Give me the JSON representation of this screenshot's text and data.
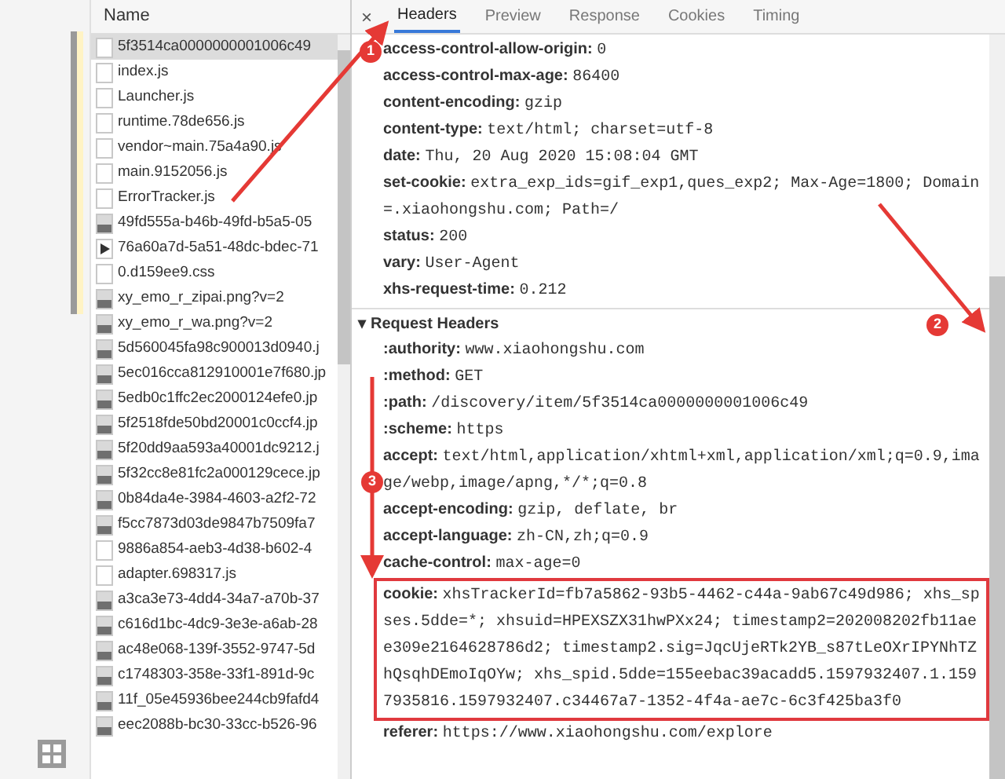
{
  "files": {
    "column": "Name",
    "items": [
      {
        "name": "5f3514ca0000000001006c49",
        "kind": "doc",
        "selected": true
      },
      {
        "name": "index.js",
        "kind": "doc",
        "selected": false
      },
      {
        "name": "Launcher.js",
        "kind": "doc",
        "selected": false
      },
      {
        "name": "runtime.78de656.js",
        "kind": "doc",
        "selected": false
      },
      {
        "name": "vendor~main.75a4a90.js",
        "kind": "doc",
        "selected": false
      },
      {
        "name": "main.9152056.js",
        "kind": "doc",
        "selected": false
      },
      {
        "name": "ErrorTracker.js",
        "kind": "doc",
        "selected": false
      },
      {
        "name": "49fd555a-b46b-49fd-b5a5-05",
        "kind": "image",
        "selected": false
      },
      {
        "name": "76a60a7d-5a51-48dc-bdec-71",
        "kind": "media",
        "selected": false
      },
      {
        "name": "0.d159ee9.css",
        "kind": "doc",
        "selected": false
      },
      {
        "name": "xy_emo_r_zipai.png?v=2",
        "kind": "image",
        "selected": false
      },
      {
        "name": "xy_emo_r_wa.png?v=2",
        "kind": "image",
        "selected": false
      },
      {
        "name": "5d560045fa98c900013d0940.j",
        "kind": "image",
        "selected": false
      },
      {
        "name": "5ec016cca812910001e7f680.jp",
        "kind": "image",
        "selected": false
      },
      {
        "name": "5edb0c1ffc2ec2000124efe0.jp",
        "kind": "image",
        "selected": false
      },
      {
        "name": "5f2518fde50bd20001c0ccf4.jp",
        "kind": "image",
        "selected": false
      },
      {
        "name": "5f20dd9aa593a40001dc9212.j",
        "kind": "image",
        "selected": false
      },
      {
        "name": "5f32cc8e81fc2a000129cece.jp",
        "kind": "image",
        "selected": false
      },
      {
        "name": "0b84da4e-3984-4603-a2f2-72",
        "kind": "image",
        "selected": false
      },
      {
        "name": "f5cc7873d03de9847b7509fa7",
        "kind": "image",
        "selected": false
      },
      {
        "name": "9886a854-aeb3-4d38-b602-4",
        "kind": "doc",
        "selected": false
      },
      {
        "name": "adapter.698317.js",
        "kind": "doc",
        "selected": false
      },
      {
        "name": "a3ca3e73-4dd4-34a7-a70b-37",
        "kind": "image",
        "selected": false
      },
      {
        "name": "c616d1bc-4dc9-3e3e-a6ab-28",
        "kind": "image",
        "selected": false
      },
      {
        "name": "ac48e068-139f-3552-9747-5d",
        "kind": "image",
        "selected": false
      },
      {
        "name": "c1748303-358e-33f1-891d-9c",
        "kind": "image",
        "selected": false
      },
      {
        "name": "11f_05e45936bee244cb9fafd4",
        "kind": "image",
        "selected": false
      },
      {
        "name": "eec2088b-bc30-33cc-b526-96",
        "kind": "image",
        "selected": false
      }
    ]
  },
  "detail": {
    "close": "×",
    "tabs": [
      {
        "label": "Headers",
        "selected": true
      },
      {
        "label": "Preview",
        "selected": false
      },
      {
        "label": "Response",
        "selected": false
      },
      {
        "label": "Cookies",
        "selected": false
      },
      {
        "label": "Timing",
        "selected": false
      }
    ],
    "response_headers": [
      {
        "key": "access-control-allow-origin:",
        "value": "0",
        "highlighted": false
      },
      {
        "key": "access-control-max-age:",
        "value": "86400",
        "highlighted": false
      },
      {
        "key": "content-encoding:",
        "value": "gzip",
        "highlighted": false
      },
      {
        "key": "content-type:",
        "value": "text/html; charset=utf-8",
        "highlighted": false
      },
      {
        "key": "date:",
        "value": "Thu, 20 Aug 2020 15:08:04 GMT",
        "highlighted": false
      },
      {
        "key": "set-cookie:",
        "value": "extra_exp_ids=gif_exp1,ques_exp2; Max-Age=1800; Domain=.xiaohongshu.com; Path=/",
        "highlighted": false
      },
      {
        "key": "status:",
        "value": "200",
        "highlighted": false
      },
      {
        "key": "vary:",
        "value": "User-Agent",
        "highlighted": false
      },
      {
        "key": "xhs-request-time:",
        "value": "0.212",
        "highlighted": false
      }
    ],
    "request_section": {
      "toggle": "▾",
      "title": "Request Headers",
      "expanded": true
    },
    "request_headers": [
      {
        "key": ":authority:",
        "value": "www.xiaohongshu.com",
        "highlighted": false
      },
      {
        "key": ":method:",
        "value": "GET",
        "highlighted": false
      },
      {
        "key": ":path:",
        "value": "/discovery/item/5f3514ca0000000001006c49",
        "highlighted": false
      },
      {
        "key": ":scheme:",
        "value": "https",
        "highlighted": false
      },
      {
        "key": "accept:",
        "value": "text/html,application/xhtml+xml,application/xml;q=0.9,image/webp,image/apng,*/*;q=0.8",
        "highlighted": false
      },
      {
        "key": "accept-encoding:",
        "value": "gzip, deflate, br",
        "highlighted": false
      },
      {
        "key": "accept-language:",
        "value": "zh-CN,zh;q=0.9",
        "highlighted": false
      },
      {
        "key": "cache-control:",
        "value": "max-age=0",
        "highlighted": false
      },
      {
        "key": "cookie:",
        "value": "xhsTrackerId=fb7a5862-93b5-4462-c44a-9ab67c49d986; xhs_spses.5dde=*; xhsuid=HPEXSZX31hwPXx24; timestamp2=202008202fb11aee309e2164628786d2; timestamp2.sig=JqcUjeRTk2YB_s87tLeOXrIPYNhTZhQsqhDEmoIqOYw; xhs_spid.5dde=155eebac39acadd5.1597932407.1.1597935816.1597932407.c34467a7-1352-4f4a-ae7c-6c3f425ba3f0",
        "highlighted": true
      },
      {
        "key": "referer:",
        "value": "https://www.xiaohongshu.com/explore",
        "highlighted": false
      }
    ]
  },
  "annotations": [
    {
      "number": "1"
    },
    {
      "number": "2"
    },
    {
      "number": "3"
    }
  ]
}
